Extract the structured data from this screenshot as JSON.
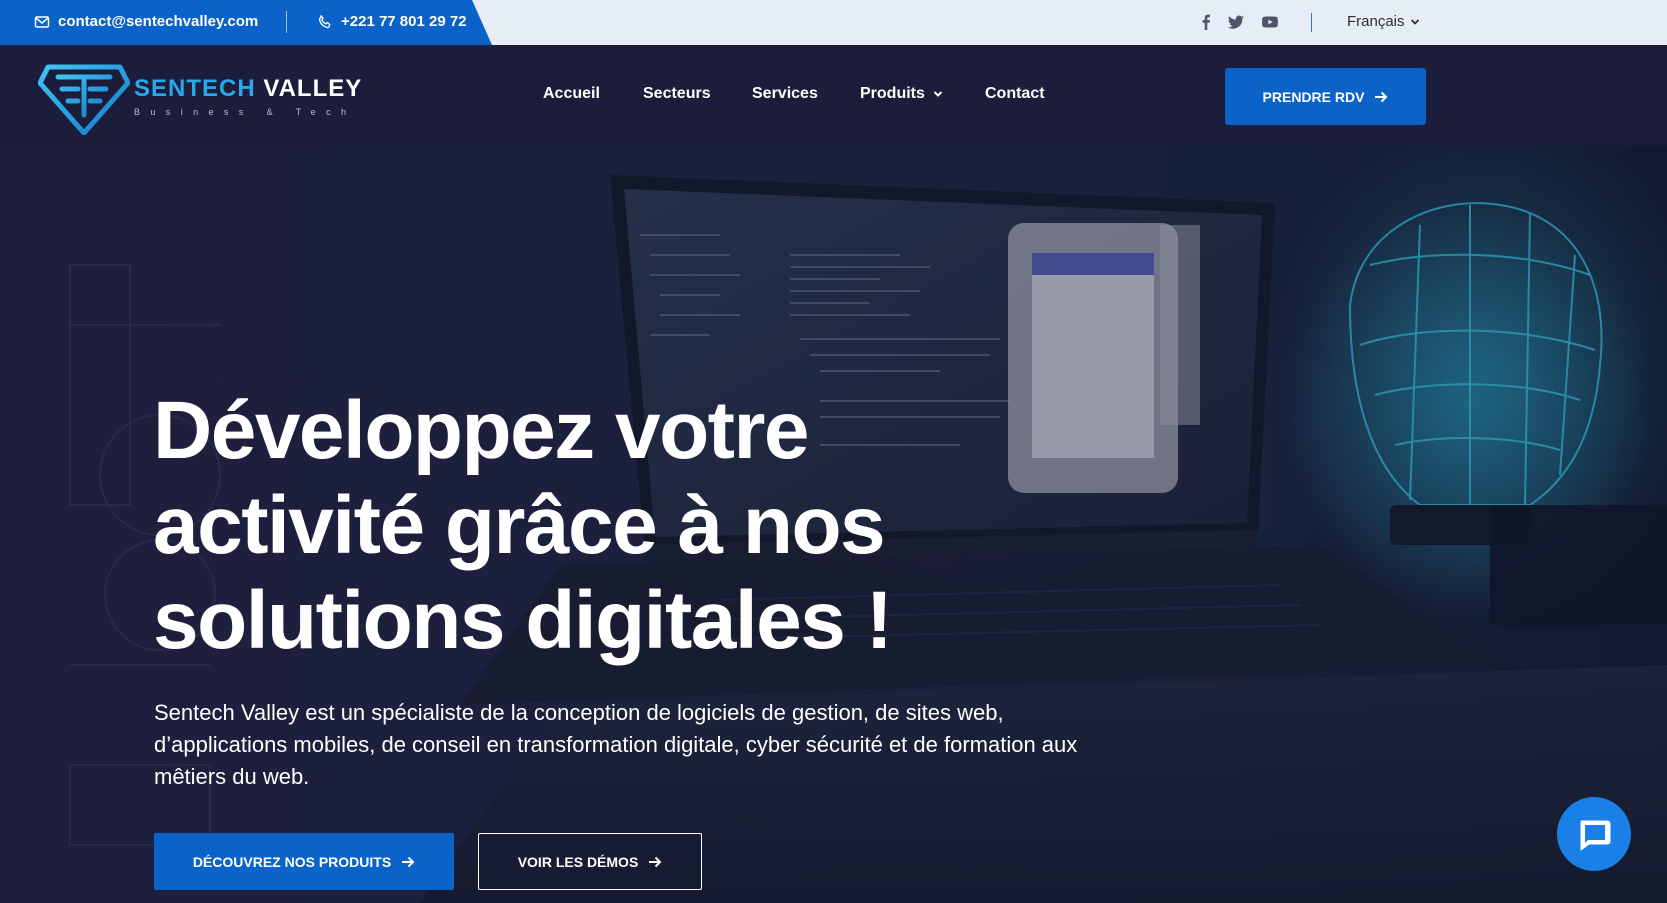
{
  "topbar": {
    "email": "contact@sentechvalley.com",
    "phone": "+221 77 801 29 72",
    "social": [
      "facebook-icon",
      "twitter-icon",
      "youtube-icon"
    ],
    "language": "Français"
  },
  "header": {
    "logo": {
      "name_part1": "SENTECH",
      "name_part2": "VALLEY",
      "tagline": "Business & Tech"
    },
    "nav": {
      "accueil": "Accueil",
      "secteurs": "Secteurs",
      "services": "Services",
      "produits": "Produits",
      "contact": "Contact"
    },
    "cta": "PRENDRE RDV"
  },
  "hero": {
    "title": "Développez votre activité grâce à nos solutions digitales !",
    "description": "Sentech Valley est un spécialiste de la conception de logiciels de gestion, de sites web, d’applications mobiles, de conseil en transformation digitale, cyber sécurité et de formation aux mêtiers du web.",
    "primary_button": "DÉCOUVREZ NOS PRODUITS",
    "secondary_button": "VOIR LES DÉMOS"
  },
  "colors": {
    "brand_blue": "#0b63c9",
    "logo_cyan": "#29a8ea",
    "background_navy": "#1c1d3a",
    "topbar_light": "#e6edf6"
  }
}
